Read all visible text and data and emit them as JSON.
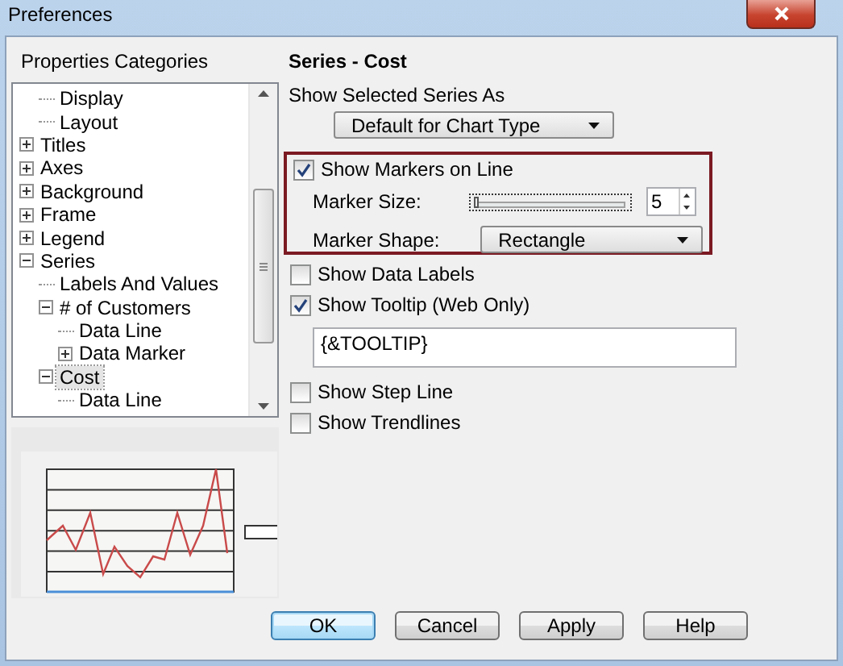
{
  "window": {
    "title": "Preferences"
  },
  "categories": {
    "label": "Properties Categories",
    "tree_top": [
      {
        "label": "Display",
        "selected": false
      },
      {
        "label": "Layout",
        "selected": false
      }
    ],
    "tree": [
      {
        "label": "Titles",
        "expanded": false,
        "selected": false
      },
      {
        "label": "Axes",
        "expanded": false,
        "selected": false
      },
      {
        "label": "Background",
        "expanded": false,
        "selected": false
      },
      {
        "label": "Frame",
        "expanded": false,
        "selected": false
      },
      {
        "label": "Legend",
        "expanded": false,
        "selected": false
      },
      {
        "label": "Series",
        "expanded": true,
        "selected": false,
        "children": [
          {
            "label": "Labels And Values",
            "selected": false
          },
          {
            "label": "# of Customers",
            "expanded": true,
            "selected": false,
            "children": [
              {
                "label": "Data Line",
                "selected": false
              },
              {
                "label": "Data Marker",
                "expanded": false,
                "selected": false
              }
            ]
          },
          {
            "label": "Cost",
            "expanded": true,
            "selected": true,
            "children": [
              {
                "label": "Data Line",
                "selected": false
              }
            ]
          }
        ]
      }
    ]
  },
  "heading": "Series - Cost",
  "show_as": {
    "label": "Show Selected Series As",
    "value": "Default for Chart Type"
  },
  "markers": {
    "label": "Show Markers on Line",
    "checked": true,
    "size_label": "Marker Size:",
    "size": {
      "level": 0.0,
      "value": "5"
    },
    "shape_label": "Marker Shape:",
    "shape_value": "Rectangle"
  },
  "options": [
    {
      "kind": "checkbox",
      "label": "Show Data Labels",
      "checked": false
    },
    {
      "kind": "checkbox",
      "label": "Show Tooltip (Web Only)",
      "checked": true
    },
    {
      "kind": "field",
      "value": "{&TOOLTIP}"
    },
    {
      "kind": "checkbox",
      "label": "Show Step Line",
      "checked": false
    },
    {
      "kind": "checkbox",
      "label": "Show Trendlines",
      "checked": false
    }
  ],
  "buttons": [
    {
      "label": "OK",
      "default": true
    },
    {
      "label": "Cancel",
      "default": false
    },
    {
      "label": "Apply",
      "default": false
    },
    {
      "label": "Help",
      "default": false
    }
  ]
}
